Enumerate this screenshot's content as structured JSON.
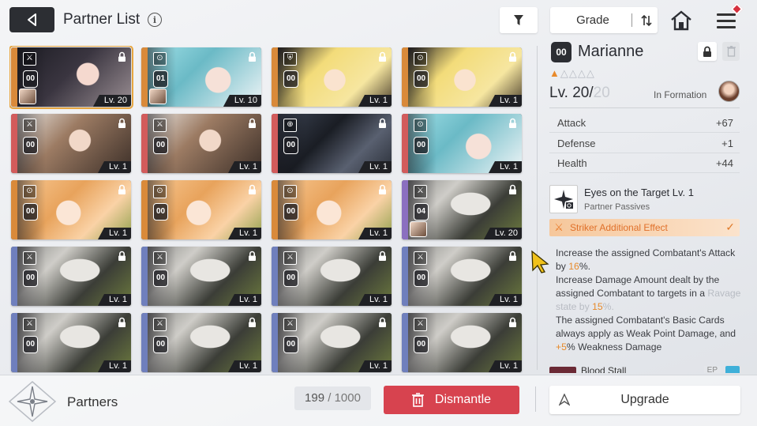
{
  "header": {
    "title": "Partner List",
    "info_icon": "i",
    "sort_label": "Grade"
  },
  "colors": {
    "accent_orange": "#e78a2b",
    "dismantle_red": "#d7434f",
    "selected_outline": "#e7a640",
    "notification": "#d6303e"
  },
  "cards": [
    {
      "role": "⚔",
      "badge": "00",
      "level": "Lv. 20",
      "stripe": "#d98a3a",
      "art": "dark-hair",
      "selected": true,
      "avatar": true
    },
    {
      "role": "⊙",
      "badge": "01",
      "level": "Lv. 10",
      "stripe": "#d98a3a",
      "art": "teal-hair",
      "avatar": true
    },
    {
      "role": "⛨",
      "badge": "00",
      "level": "Lv. 1",
      "stripe": "#d98a3a",
      "art": "blonde"
    },
    {
      "role": "⊙",
      "badge": "00",
      "level": "Lv. 1",
      "stripe": "#d98a3a",
      "art": "blonde"
    },
    {
      "role": "⚔",
      "badge": "00",
      "level": "Lv. 1",
      "stripe": "#d25b5b",
      "art": "brown-hair"
    },
    {
      "role": "⚔",
      "badge": "00",
      "level": "Lv. 1",
      "stripe": "#d25b5b",
      "art": "brown-hair"
    },
    {
      "role": "⊕",
      "badge": "00",
      "level": "Lv. 1",
      "stripe": "#d25b5b",
      "art": "dark-feather"
    },
    {
      "role": "⊙",
      "badge": "00",
      "level": "Lv. 1",
      "stripe": "#d25b5b",
      "art": "teal-hair"
    },
    {
      "role": "⊙",
      "badge": "00",
      "level": "Lv. 1",
      "stripe": "#d98a3a",
      "art": "ginger"
    },
    {
      "role": "⊙",
      "badge": "00",
      "level": "Lv. 1",
      "stripe": "#d98a3a",
      "art": "ginger"
    },
    {
      "role": "⊙",
      "badge": "00",
      "level": "Lv. 1",
      "stripe": "#d98a3a",
      "art": "ginger"
    },
    {
      "role": "⚔",
      "badge": "04",
      "level": "Lv. 20",
      "stripe": "#8b6fc0",
      "art": "mask",
      "avatar": true
    },
    {
      "role": "⚔",
      "badge": "00",
      "level": "Lv. 1",
      "stripe": "#6f7fbd",
      "art": "mask"
    },
    {
      "role": "⚔",
      "badge": "00",
      "level": "Lv. 1",
      "stripe": "#6f7fbd",
      "art": "mask"
    },
    {
      "role": "⚔",
      "badge": "00",
      "level": "Lv. 1",
      "stripe": "#6f7fbd",
      "art": "mask"
    },
    {
      "role": "⚔",
      "badge": "00",
      "level": "Lv. 1",
      "stripe": "#6f7fbd",
      "art": "mask"
    },
    {
      "role": "⚔",
      "badge": "00",
      "level": "Lv. 1",
      "stripe": "#6f7fbd",
      "art": "mask"
    },
    {
      "role": "⚔",
      "badge": "00",
      "level": "Lv. 1",
      "stripe": "#6f7fbd",
      "art": "mask"
    },
    {
      "role": "⚔",
      "badge": "00",
      "level": "Lv. 1",
      "stripe": "#6f7fbd",
      "art": "mask"
    },
    {
      "role": "⚔",
      "badge": "00",
      "level": "Lv. 1",
      "stripe": "#6f7fbd",
      "art": "mask"
    }
  ],
  "detail": {
    "badge": "00",
    "name": "Marianne",
    "stars_filled": 1,
    "stars_total": 5,
    "level_current": "Lv. 20",
    "level_sep": "/",
    "level_max": "20",
    "formation": "In Formation",
    "stats": [
      {
        "label": "Attack",
        "value": "+67"
      },
      {
        "label": "Defense",
        "value": "+1"
      },
      {
        "label": "Health",
        "value": "+44"
      }
    ],
    "skill_name": "Eyes on the Target Lv. 1",
    "skill_sub": "Partner Passives",
    "effect_label": "Striker Additional Effect",
    "effect_lines": {
      "l1a": "Increase the assigned Combatant's Attack by ",
      "l1b": "16",
      "l1c": "%.",
      "l2a": "Increase Damage Amount dealt by the assigned Combatant to targets in a ",
      "l2b": "Ravage state by ",
      "l2c": "15",
      "l2d": "%.",
      "l3a": "The assigned Combatant's Basic Cards always apply as Weak Point Damage, and ",
      "l3b": "+5",
      "l3c": "% Weakness Damage"
    },
    "next_partner_name": "Blood Stall",
    "next_partner_tag": "EP"
  },
  "footer": {
    "section_label": "Partners",
    "count_current": "199",
    "count_sep": " / ",
    "count_total": "1000",
    "dismantle_label": "Dismantle",
    "upgrade_label": "Upgrade"
  }
}
